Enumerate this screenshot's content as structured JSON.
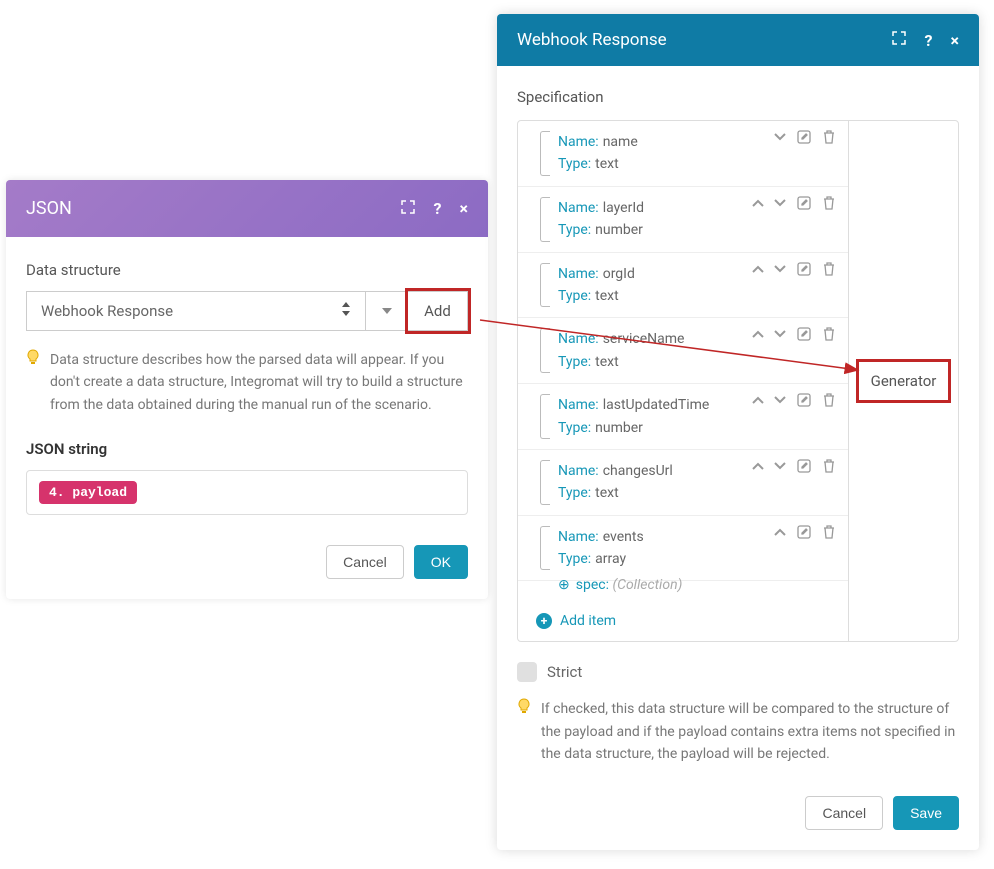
{
  "json_panel": {
    "title": "JSON",
    "data_structure_label": "Data structure",
    "select_value": "Webhook Response",
    "add_button": "Add",
    "help": "Data structure describes how the parsed data will appear. If you don't create a data structure, Integromat will try to build a structure from the data obtained during the manual run of the scenario.",
    "json_string_label": "JSON string",
    "tag": "4. payload",
    "cancel": "Cancel",
    "ok": "OK"
  },
  "wr_panel": {
    "title": "Webhook Response",
    "specification_label": "Specification",
    "items": [
      {
        "name": "name",
        "type": "text",
        "up": false,
        "down": true
      },
      {
        "name": "layerId",
        "type": "number",
        "up": true,
        "down": true
      },
      {
        "name": "orgId",
        "type": "text",
        "up": true,
        "down": true
      },
      {
        "name": "serviceName",
        "type": "text",
        "up": true,
        "down": true
      },
      {
        "name": "lastUpdatedTime",
        "type": "number",
        "up": true,
        "down": true
      },
      {
        "name": "changesUrl",
        "type": "text",
        "up": true,
        "down": true
      },
      {
        "name": "events",
        "type": "array",
        "up": true,
        "down": false,
        "has_spec": true
      }
    ],
    "spec_label": "spec:",
    "spec_type": "(Collection)",
    "add_item": "Add item",
    "generator": "Generator",
    "strict_label": "Strict",
    "strict_help": "If checked, this data structure will be compared to the structure of the payload and if the payload contains extra items not specified in the data structure, the payload will be rejected.",
    "cancel": "Cancel",
    "save": "Save",
    "name_key": "Name:",
    "type_key": "Type:"
  }
}
